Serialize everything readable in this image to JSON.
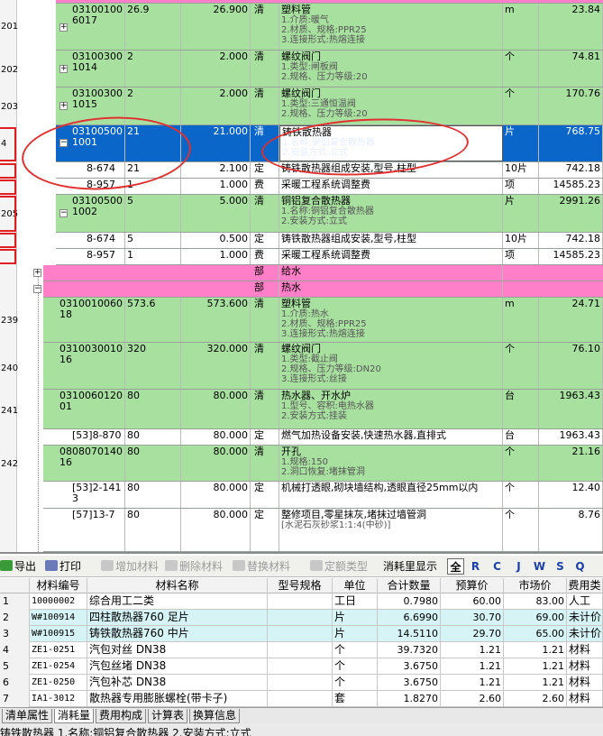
{
  "left_row_numbers": [
    "201",
    "202",
    "203",
    "4",
    "205",
    "239",
    "240",
    "241",
    "242"
  ],
  "bill_rows": [
    {
      "code": "031001006017",
      "qty": "26.9",
      "qty_calc": "26.900",
      "type": "清",
      "name": "塑料管",
      "features": [
        "1.介质:暖气",
        "2.材质、规格:PPR25",
        "3.连接形式:热熔连接"
      ],
      "unit": "m",
      "price": "23.84"
    },
    {
      "code": "031003001014",
      "qty": "2",
      "qty_calc": "2.000",
      "type": "清",
      "name": "螺纹阀门",
      "features": [
        "1.类型:闸板阀",
        "2.规格、压力等级:20"
      ],
      "unit": "个",
      "price": "74.81"
    },
    {
      "code": "031003001015",
      "qty": "2",
      "qty_calc": "2.000",
      "type": "清",
      "name": "螺纹阀门",
      "features": [
        "1.类型:三通恒温阀",
        "2.规格、压力等级:20"
      ],
      "unit": "个",
      "price": "170.76"
    },
    {
      "code": "031005001001",
      "qty": "21",
      "qty_calc": "21.000",
      "type": "清",
      "name": "铸铁散热器",
      "features": [
        "1.名称:铜铝复合散热器",
        "2.安装方式:立式"
      ],
      "unit": "片",
      "price": "768.75"
    },
    {
      "code": "8-674",
      "qty": "21",
      "qty_calc": "2.100",
      "type": "定",
      "name": "铸铁散热器组成安装,型号,柱型",
      "features": [],
      "unit": "10片",
      "price": "742.18"
    },
    {
      "code": "8-957",
      "qty": "1",
      "qty_calc": "1.000",
      "type": "费",
      "name": "采暖工程系统调整费",
      "features": [],
      "unit": "项",
      "price": "14585.23"
    },
    {
      "code": "031005001002",
      "qty": "5",
      "qty_calc": "5.000",
      "type": "清",
      "name": "铜铝复合散热器",
      "features": [
        "1.名称:铜铝复合散热器",
        "2.安装方式:立式"
      ],
      "unit": "片",
      "price": "2991.26"
    },
    {
      "code": "8-674",
      "qty": "5",
      "qty_calc": "0.500",
      "type": "定",
      "name": "铸铁散热器组成安装,型号,柱型",
      "features": [],
      "unit": "10片",
      "price": "742.18"
    },
    {
      "code": "8-957",
      "qty": "1",
      "qty_calc": "1.000",
      "type": "费",
      "name": "采暖工程系统调整费",
      "features": [],
      "unit": "项",
      "price": "14585.23"
    },
    {
      "code": "",
      "qty": "",
      "qty_calc": "",
      "type": "部",
      "name": "给水",
      "features": [],
      "unit": "",
      "price": ""
    },
    {
      "code": "",
      "qty": "",
      "qty_calc": "",
      "type": "部",
      "name": "热水",
      "features": [],
      "unit": "",
      "price": ""
    },
    {
      "code": "031001006018",
      "qty": "573.6",
      "qty_calc": "573.600",
      "type": "清",
      "name": "塑料管",
      "features": [
        "1.介质:热水",
        "2.材质、规格:PPR25",
        "3.连接形式:热熔连接"
      ],
      "unit": "m",
      "price": "24.71"
    },
    {
      "code": "031003001016",
      "qty": "320",
      "qty_calc": "320.000",
      "type": "清",
      "name": "螺纹阀门",
      "features": [
        "1.类型:截止阀",
        "2.规格、压力等级:DN20",
        "3.连接形式:丝接"
      ],
      "unit": "个",
      "price": "76.10"
    },
    {
      "code": "031006012001",
      "qty": "80",
      "qty_calc": "80.000",
      "type": "清",
      "name": "热水器、开水炉",
      "features": [
        "1.型号、容积:电热水器",
        "2.安装方式:挂装"
      ],
      "unit": "台",
      "price": "1963.43"
    },
    {
      "code": "[53]8-870",
      "qty": "80",
      "qty_calc": "80.000",
      "type": "定",
      "name": "燃气加热设备安装,快速热水器,直排式",
      "features": [],
      "unit": "台",
      "price": "1963.43"
    },
    {
      "code": "080807014016",
      "qty": "80",
      "qty_calc": "80.000",
      "type": "清",
      "name": "开孔",
      "features": [
        "1.规格:150",
        "2.洞口恢复:堵抹管洞"
      ],
      "unit": "个",
      "price": "21.16"
    },
    {
      "code": "[53]2-1413",
      "qty": "80",
      "qty_calc": "80.000",
      "type": "定",
      "name": "机械打透眼,砌块墙结构,透眼直径25mm以内",
      "features": [],
      "unit": "个",
      "price": "12.40"
    },
    {
      "code": "[57]13-7",
      "qty": "80",
      "qty_calc": "80.000",
      "type": "定",
      "name": "整修项目,零星抹灰,堵抹过墙管洞",
      "features": [
        "[水泥石灰砂浆1:1:4(中砂)]"
      ],
      "unit": "个",
      "price": "8.76"
    }
  ],
  "toolbar": {
    "export": "导出",
    "print": "打印",
    "add_material": "增加材料",
    "delete_material": "删除材料",
    "replace_material": "替换材料",
    "quota_type": "定额类型",
    "consumption_display": "消耗里显示",
    "filters": [
      "全",
      "R",
      "C",
      "J",
      "W",
      "S",
      "Q"
    ]
  },
  "material_headers": [
    "材料编号",
    "材料名称",
    "型号规格",
    "单位",
    "合计数量",
    "预算价",
    "市场价",
    "费用类"
  ],
  "materials": [
    {
      "idx": "1",
      "code": "10000002",
      "name": "综合用工二类",
      "spec": "",
      "unit": "工日",
      "qty": "0.7980",
      "budget": "60.00",
      "market": "83.00",
      "cat": "人工"
    },
    {
      "idx": "2",
      "code": "W#100914",
      "name": "四柱散热器760 足片",
      "spec": "",
      "unit": "片",
      "qty": "6.6990",
      "budget": "30.70",
      "market": "69.00",
      "cat": "未计价"
    },
    {
      "idx": "3",
      "code": "W#100915",
      "name": "铸铁散热器760 中片",
      "spec": "",
      "unit": "片",
      "qty": "14.5110",
      "budget": "29.70",
      "market": "65.00",
      "cat": "未计价"
    },
    {
      "idx": "4",
      "code": "ZE1-0251",
      "name": "汽包对丝 DN38",
      "spec": "",
      "unit": "个",
      "qty": "39.7320",
      "budget": "1.21",
      "market": "1.21",
      "cat": "材料"
    },
    {
      "idx": "5",
      "code": "ZE1-0254",
      "name": "汽包丝堵 DN38",
      "spec": "",
      "unit": "个",
      "qty": "3.6750",
      "budget": "1.21",
      "market": "1.21",
      "cat": "材料"
    },
    {
      "idx": "6",
      "code": "ZE1-0250",
      "name": "汽包补芯 DN38",
      "spec": "",
      "unit": "个",
      "qty": "3.6750",
      "budget": "1.21",
      "market": "1.21",
      "cat": "材料"
    },
    {
      "idx": "7",
      "code": "IA1-3012",
      "name": "散热器专用膨胀螺栓(带卡子)",
      "spec": "",
      "unit": "套",
      "qty": "1.8270",
      "budget": "2.60",
      "market": "2.60",
      "cat": "材料"
    }
  ],
  "tabs": [
    "清单属性",
    "消耗量",
    "费用构成",
    "计算表",
    "换算信息"
  ],
  "status_text": "铸铁散热器  1.名称:铜铝复合散热器  2.安装方式:立式"
}
